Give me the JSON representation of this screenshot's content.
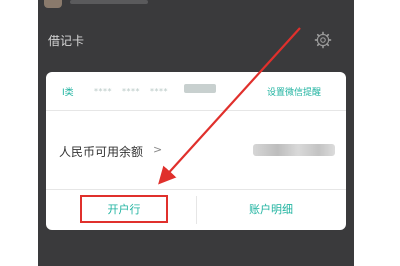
{
  "header": {
    "section_title": "借记卡"
  },
  "card": {
    "type_label": "I类",
    "masked_groups": [
      "****",
      "****",
      "****"
    ],
    "wechat_remind": "设置微信提醒",
    "balance_label": "人民币可用余额",
    "balance_chevron": ">",
    "bank_button": "开户行",
    "detail_button": "账户明细"
  },
  "icons": {
    "settings": "gear-icon",
    "chevron": "chevron-right-icon"
  },
  "colors": {
    "accent": "#1fb3a0",
    "highlight": "#e0302c",
    "background": "#3a3a3c",
    "card": "#ffffff"
  }
}
